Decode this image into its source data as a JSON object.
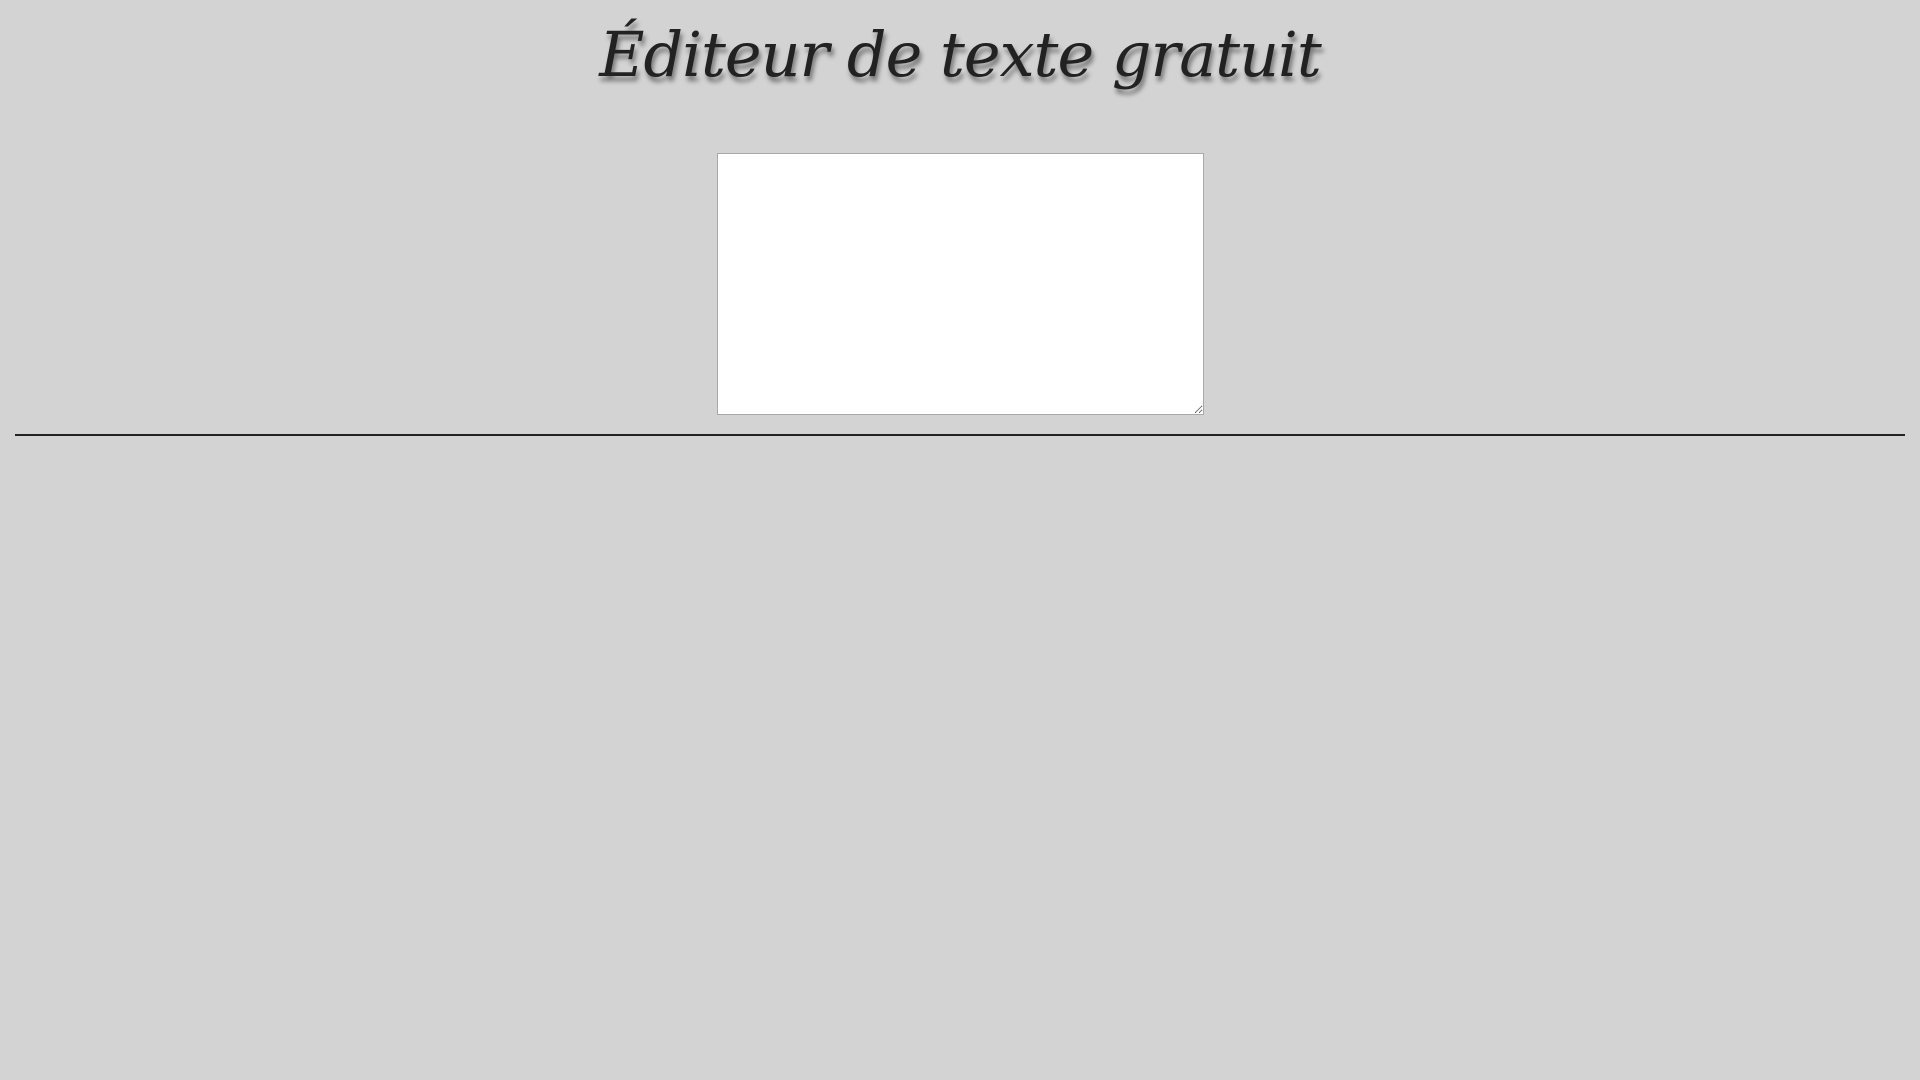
{
  "page": {
    "title": "Éditeur de texte gratuit"
  },
  "editor": {
    "value": "",
    "placeholder": ""
  },
  "colors": {
    "background": "#d3d3d3",
    "title_text": "#222222",
    "editor_background": "#ffffff",
    "editor_border": "#a9a9a9",
    "divider": "#222222"
  }
}
